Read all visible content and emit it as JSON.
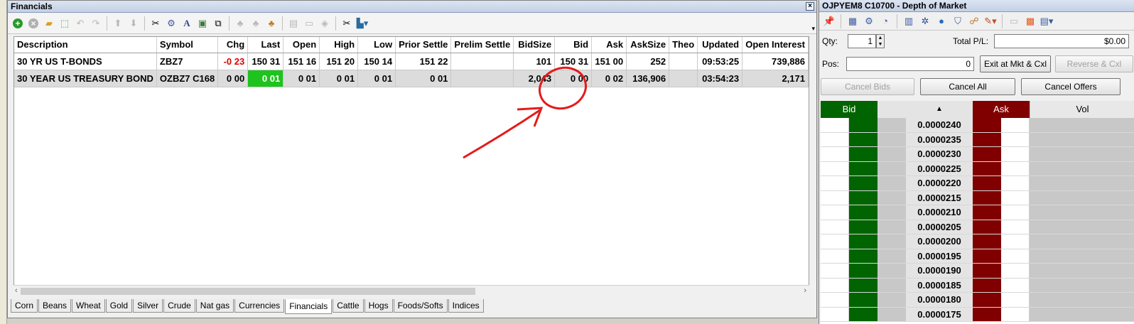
{
  "financials": {
    "title": "Financials",
    "columns": [
      "Description",
      "Symbol",
      "Chg",
      "Last",
      "Open",
      "High",
      "Low",
      "Prior Settle",
      "Prelim Settle",
      "BidSize",
      "Bid",
      "Ask",
      "AskSize",
      "Theo",
      "Updated",
      "Open Interest"
    ],
    "rows": [
      [
        "30 YR US T-BONDS",
        "ZBZ7",
        "-0 23",
        "150 31",
        "151 16",
        "151 20",
        "150 14",
        "151 22",
        "",
        "101",
        "150 31",
        "151 00",
        "252",
        "",
        "09:53:25",
        "739,886"
      ],
      [
        "30 YEAR US TREASURY BOND",
        "OZBZ7 C168",
        "0 00",
        "0 01",
        "0 01",
        "0 01",
        "0 01",
        "0 01",
        "",
        "2,043",
        "0 00",
        "0 02",
        "136,906",
        "",
        "03:54:23",
        "2,171"
      ]
    ],
    "tabs": [
      "Corn",
      "Beans",
      "Wheat",
      "Gold",
      "Silver",
      "Crude",
      "Nat gas",
      "Currencies",
      "Financials",
      "Cattle",
      "Hogs",
      "Foods/Softs",
      "Indices"
    ],
    "active_tab": "Financials"
  },
  "dom": {
    "title": "OJPYEM8 C10700 - Depth of Market",
    "qty_label": "Qty:",
    "qty_value": "1",
    "total_pl_label": "Total P/L:",
    "total_pl_value": "$0.00",
    "pos_label": "Pos:",
    "pos_value": "0",
    "exit_button": "Exit at Mkt & Cxl",
    "reverse_button": "Reverse & Cxl",
    "cancel_bids": "Cancel Bids",
    "cancel_all": "Cancel All",
    "cancel_offers": "Cancel Offers",
    "ladder_headers": {
      "bid": "Bid",
      "price": "▲",
      "ask": "Ask",
      "vol": "Vol"
    },
    "prices": [
      "0.0000240",
      "0.0000235",
      "0.0000230",
      "0.0000225",
      "0.0000220",
      "0.0000215",
      "0.0000210",
      "0.0000205",
      "0.0000200",
      "0.0000195",
      "0.0000190",
      "0.0000185",
      "0.0000180",
      "0.0000175"
    ]
  },
  "colors": {
    "bid": "#006400",
    "ask": "#800000",
    "highlight_last": "#1ec31e",
    "negative": "#e00000",
    "annotation": "#e31b1b"
  }
}
